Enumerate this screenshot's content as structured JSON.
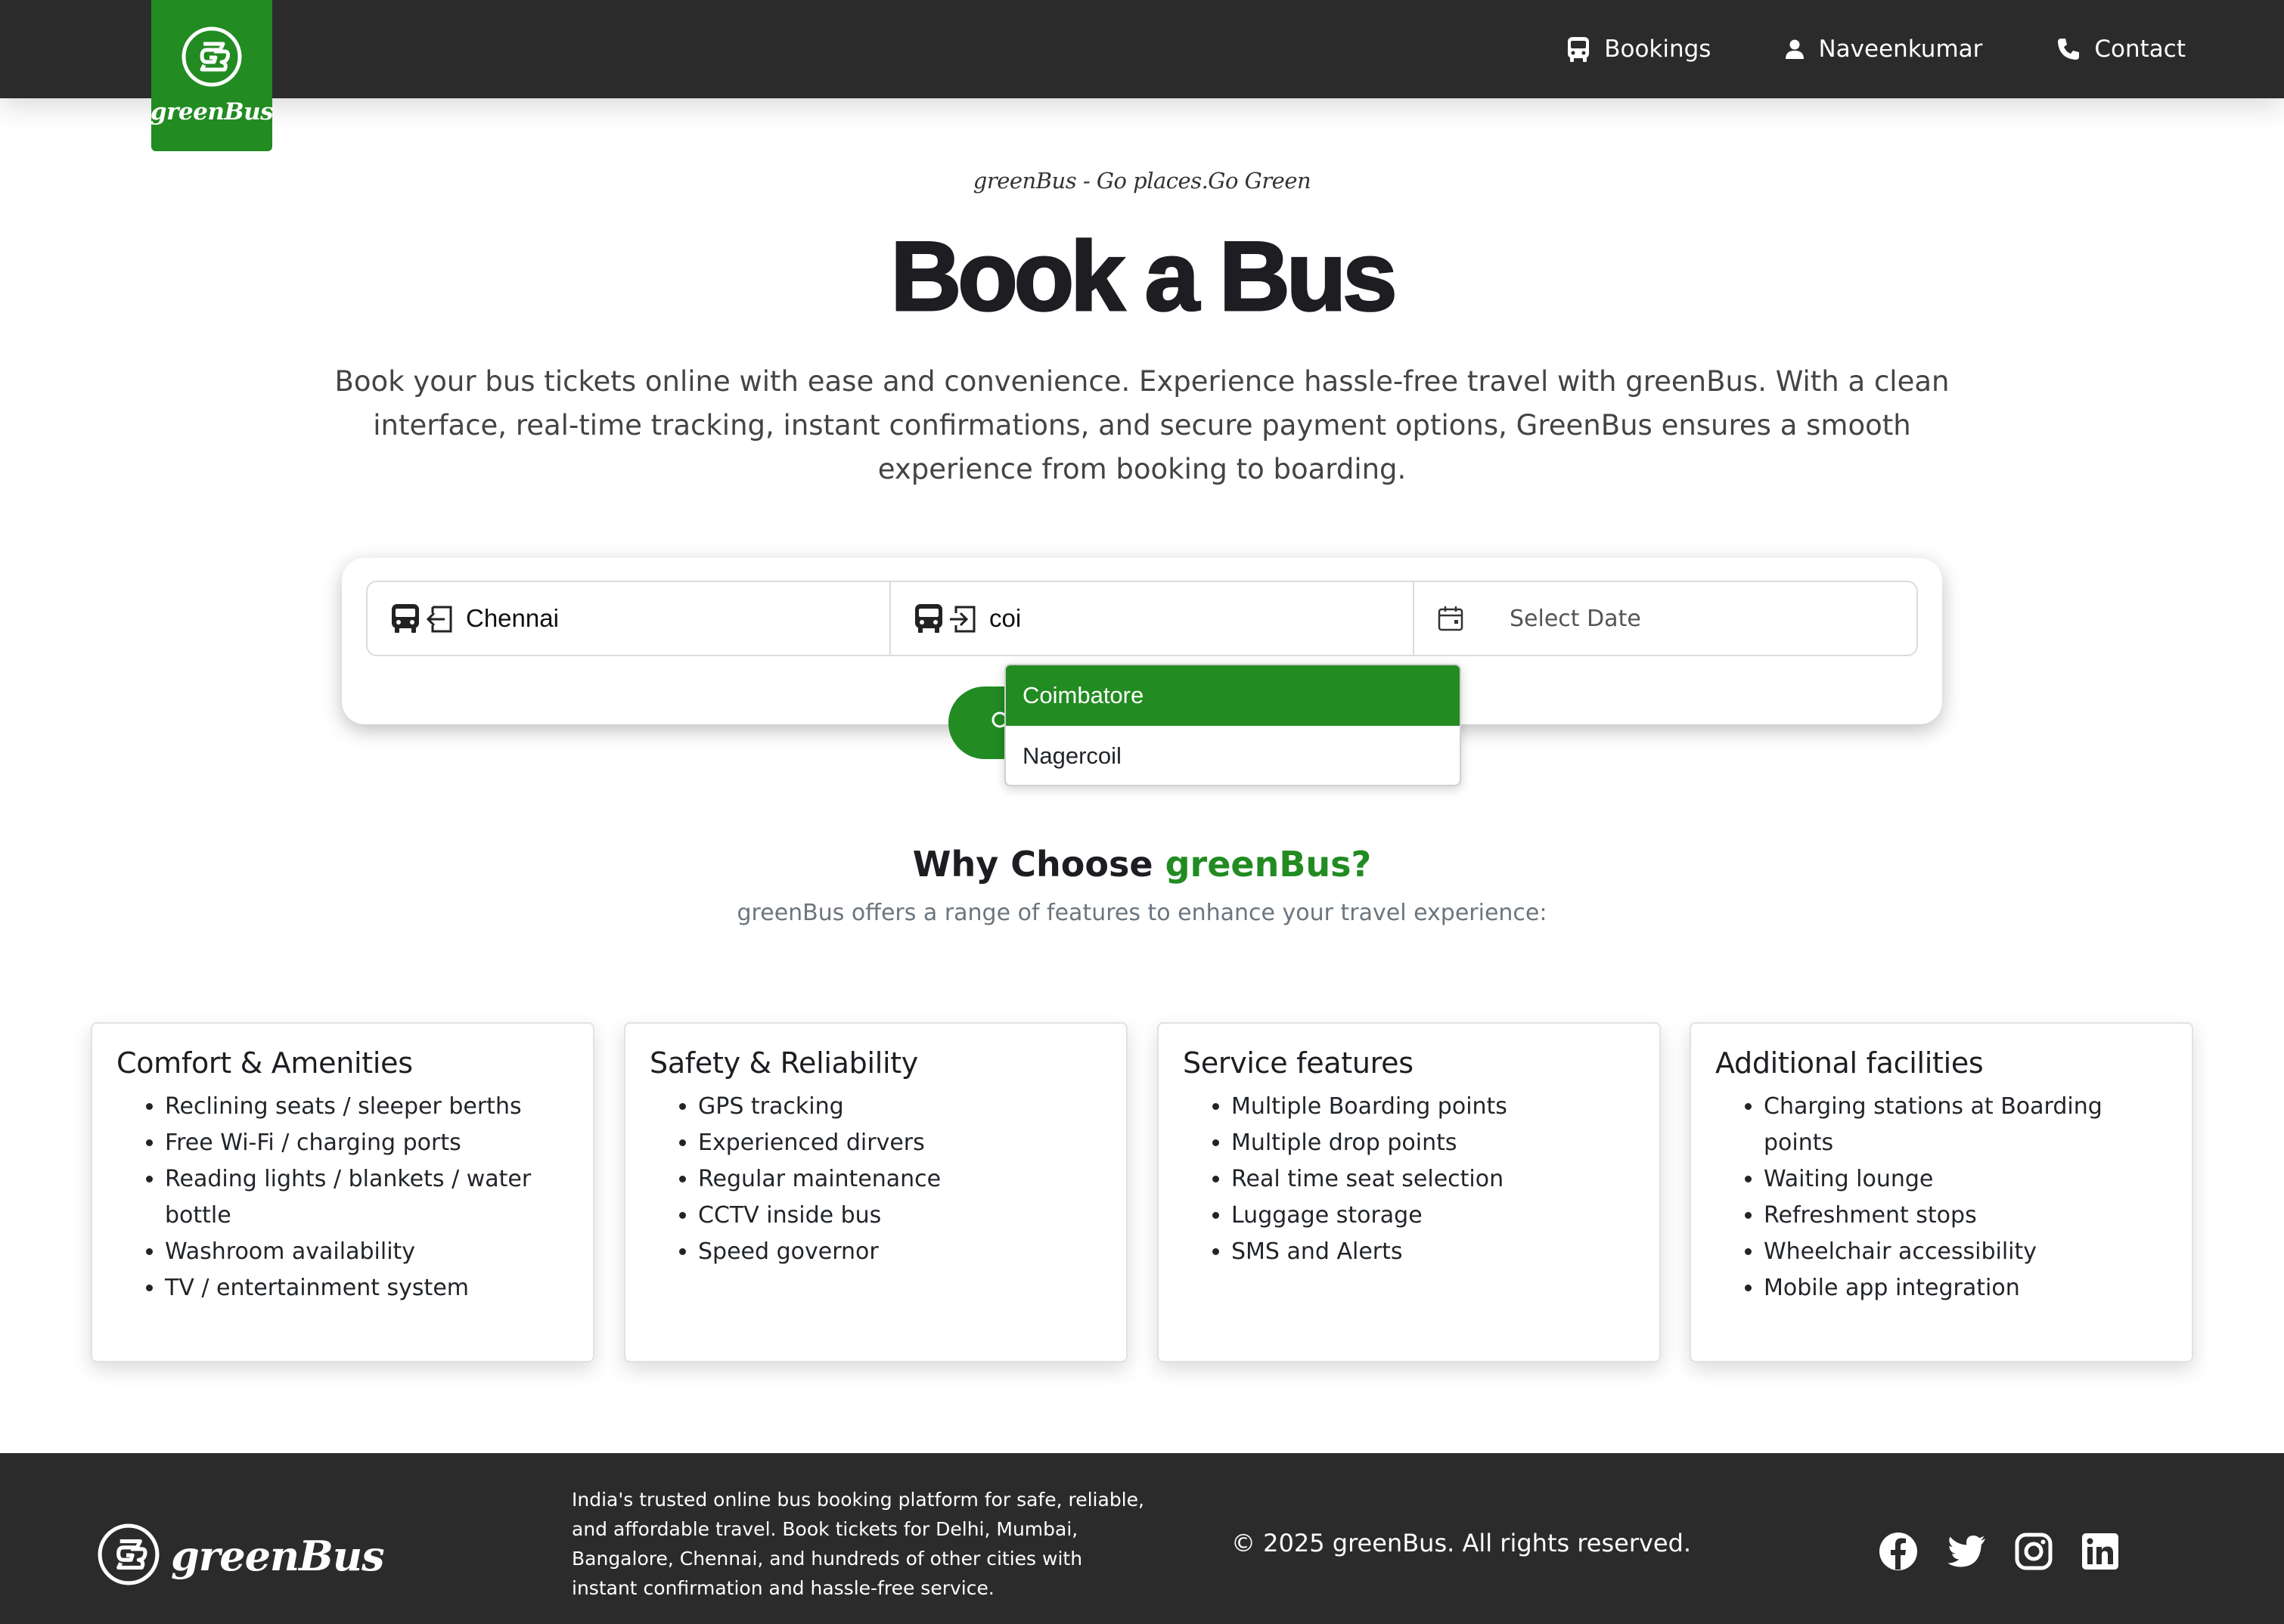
{
  "brand": {
    "name": "greenBus",
    "accent_color": "#228b22"
  },
  "nav": {
    "links": [
      {
        "label": "Bookings",
        "icon": "bus-icon"
      },
      {
        "label": "Naveenkumar",
        "icon": "user-icon"
      },
      {
        "label": "Contact",
        "icon": "phone-icon"
      }
    ]
  },
  "hero": {
    "tagline": "greenBus - Go places.Go Green",
    "title": "Book a Bus",
    "description": "Book your bus tickets online with ease and convenience. Experience hassle-free travel with greenBus. With a clean interface, real-time tracking, instant confirmations, and secure payment options, GreenBus ensures a smooth experience from booking to boarding."
  },
  "search": {
    "from_value": "Chennai",
    "to_value": "coi",
    "date_placeholder": "Select Date",
    "suggestions": [
      {
        "label": "Coimbatore",
        "active": true
      },
      {
        "label": "Nagercoil",
        "active": false
      }
    ]
  },
  "why": {
    "title_prefix": "Why Choose",
    "title_accent": "greenBus?",
    "subtitle": "greenBus offers a range of features to enhance your travel experience:"
  },
  "features": [
    {
      "title": "Comfort & Amenities",
      "items": [
        "Reclining seats / sleeper berths",
        "Free Wi-Fi / charging ports",
        "Reading lights / blankets / water bottle",
        "Washroom availability",
        "TV / entertainment system"
      ]
    },
    {
      "title": "Safety & Reliability",
      "items": [
        "GPS tracking",
        "Experienced dirvers",
        "Regular maintenance",
        "CCTV inside bus",
        "Speed governor"
      ]
    },
    {
      "title": "Service features",
      "items": [
        "Multiple Boarding points",
        "Multiple drop points",
        "Real time seat selection",
        "Luggage storage",
        "SMS and Alerts"
      ]
    },
    {
      "title": "Additional facilities",
      "items": [
        "Charging stations at Boarding points",
        "Waiting lounge",
        "Refreshment stops",
        "Wheelchair accessibility",
        "Mobile app integration"
      ]
    }
  ],
  "footer": {
    "about": "India's trusted online bus booking platform for safe, reliable, and affordable travel. Book tickets for Delhi, Mumbai, Bangalore, Chennai, and hundreds of other cities with instant confirmation and hassle-free service.",
    "copyright": "© 2025 greenBus. All rights reserved.",
    "socials": [
      "facebook-icon",
      "twitter-icon",
      "instagram-icon",
      "linkedin-icon"
    ]
  }
}
